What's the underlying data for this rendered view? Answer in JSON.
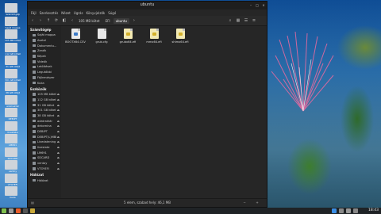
{
  "window": {
    "title": "ubuntu",
    "menu": [
      "Fájl",
      "Szerkesztés",
      "Nézet",
      "Ugrás",
      "Könyvjelzők",
      "Súgó"
    ],
    "breadcrumbs": [
      "105 MB kötet",
      "EFI",
      "ubuntu"
    ],
    "status": "5 elem, szabad hely: 46,1 MB"
  },
  "sidebar": {
    "sections": [
      {
        "title": "Számítógép",
        "items": [
          {
            "label": "Saját mappa",
            "eject": false
          },
          {
            "label": "Asztal",
            "eject": false
          },
          {
            "label": "Dokumentu...",
            "eject": false
          },
          {
            "label": "Zenék",
            "eject": false
          },
          {
            "label": "Képek",
            "eject": false
          },
          {
            "label": "Videók",
            "eject": false
          },
          {
            "label": "Letöltések",
            "eject": false
          },
          {
            "label": "Legutóbbi",
            "eject": false
          },
          {
            "label": "Fájlrendszer",
            "eject": false
          },
          {
            "label": "Kuka",
            "eject": false
          }
        ]
      },
      {
        "title": "Eszközök",
        "items": [
          {
            "label": "105 MB kötet",
            "eject": true
          },
          {
            "label": "112 GB kötet",
            "eject": true
          },
          {
            "label": "31 GB kötet",
            "eject": true
          },
          {
            "label": "301 GB kötet",
            "eject": true
          },
          {
            "label": "38 GB kötet",
            "eject": true
          },
          {
            "label": "adatraktár",
            "eject": true
          },
          {
            "label": "debcmina",
            "eject": true
          },
          {
            "label": "DEBIPT",
            "eject": true
          },
          {
            "label": "DEBIPT(L)MBI",
            "eject": true
          },
          {
            "label": "Livedatening",
            "eject": true
          },
          {
            "label": "livestate",
            "eject": true
          },
          {
            "label": "LM691",
            "eject": true
          },
          {
            "label": "SDCARD",
            "eject": true
          },
          {
            "label": "ventoy",
            "eject": true
          },
          {
            "label": "VTOYEFI",
            "eject": true
          }
        ]
      },
      {
        "title": "Hálózat",
        "items": [
          {
            "label": "Hálózat",
            "eject": false
          }
        ]
      }
    ]
  },
  "files": [
    {
      "name": "BOOTX64.CSV",
      "type": "csv"
    },
    {
      "name": "grub.cfg",
      "type": "cfg"
    },
    {
      "name": "grubx64.efi",
      "type": "efi"
    },
    {
      "name": "mmx64.efi",
      "type": "efi"
    },
    {
      "name": "shimx64.efi",
      "type": "efi"
    }
  ],
  "desktop_icons": [
    {
      "label": "Számítógép"
    },
    {
      "label": "Saját mappa"
    },
    {
      "label": "105 MB kötet"
    },
    {
      "label": "112 GB kötet"
    },
    {
      "label": "31 GB kötet"
    },
    {
      "label": "301 GB kötet"
    },
    {
      "label": "38 GB kötet"
    },
    {
      "label": "adatraktár"
    },
    {
      "label": "DEBIPT"
    },
    {
      "label": "livestate"
    },
    {
      "label": "LM691"
    },
    {
      "label": "SDCARD"
    },
    {
      "label": "ventoy"
    },
    {
      "label": "VTOYEFI"
    },
    {
      "label": "Kuka"
    }
  ],
  "panel": {
    "clock": "18:43"
  },
  "colors": {
    "accent": "#4a90d9",
    "window_bg": "#262626",
    "sidebar_bg": "#232323",
    "efi_icon": "#d4b02a",
    "csv_icon": "#3b7ac7"
  }
}
